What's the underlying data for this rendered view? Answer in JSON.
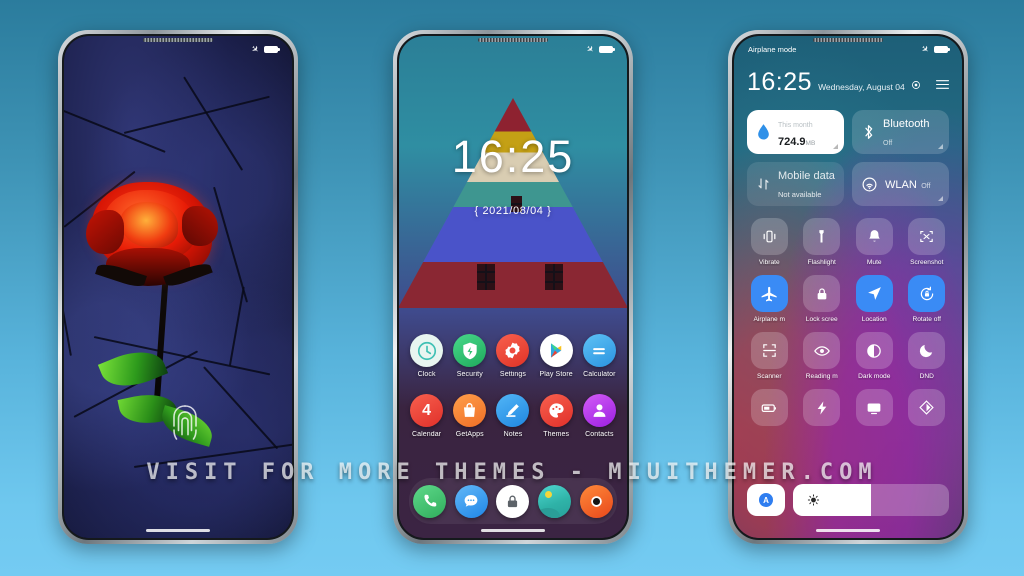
{
  "watermark": "VISIT FOR MORE THEMES - MIUITHEMER.COM",
  "background": {
    "top_color": "#2b7c9d",
    "bottom_color": "#74cbf2"
  },
  "phone1": {
    "name": "lockscreen-rose",
    "statusbar": {
      "plane_icon": "airplane-icon",
      "battery_icon": "battery-icon"
    },
    "wallpaper": "red-rose-on-cracked-blue-stone",
    "fingerprint_icon": "fingerprint-icon"
  },
  "phone2": {
    "name": "homescreen",
    "statusbar": {
      "plane_icon": "airplane-icon",
      "battery_icon": "battery-icon"
    },
    "clock": {
      "time": "16:25",
      "date": "{ 2021/08/04 }"
    },
    "app_rows": [
      [
        {
          "label": "Clock",
          "icon": "clock-icon",
          "bg": "#e8f5f0",
          "fg": "#3fc0b4"
        },
        {
          "label": "Security",
          "icon": "shield-bolt-icon",
          "bg": "#2fc16f",
          "fg": "#ffffff"
        },
        {
          "label": "Settings",
          "icon": "gear-icon",
          "bg": "#ef4a3d",
          "fg": "#ffffff"
        },
        {
          "label": "Play Store",
          "icon": "play-triangle-icon",
          "bg": "#ffffff",
          "fg": "#2fa8e0"
        },
        {
          "label": "Calculator",
          "icon": "equals-icon",
          "bg": "#3aa9e8",
          "fg": "#ffffff"
        }
      ],
      [
        {
          "label": "Calendar",
          "icon": "calendar-4-icon",
          "bg": "#ef4434",
          "fg": "#ffffff"
        },
        {
          "label": "GetApps",
          "icon": "shopping-bag-icon",
          "bg": "#f58134",
          "fg": "#ffffff"
        },
        {
          "label": "Notes",
          "icon": "pencil-icon",
          "bg": "#2e9ef0",
          "fg": "#ffffff"
        },
        {
          "label": "Themes",
          "icon": "palette-icon",
          "bg": "#ef4a3d",
          "fg": "#ffffff"
        },
        {
          "label": "Contacts",
          "icon": "person-icon",
          "bg": "#b93af0",
          "fg": "#ffffff"
        }
      ]
    ],
    "dock": [
      {
        "label": "Phone",
        "icon": "phone-handset-icon",
        "bg": "#45c173",
        "fg": "#ffffff"
      },
      {
        "label": "Messages",
        "icon": "chat-bubble-icon",
        "bg": "#3aa0f0",
        "fg": "#ffffff"
      },
      {
        "label": "Security",
        "icon": "lock-icon",
        "bg": "#ffffff",
        "fg": "#5c6268"
      },
      {
        "label": "Gallery",
        "icon": "photo-sun-icon",
        "bg": "#3fc0b4",
        "fg": "#f5d63a"
      },
      {
        "label": "Browser",
        "icon": "browser-circle-icon",
        "bg": "#f06326",
        "fg": "#111111"
      }
    ]
  },
  "phone3": {
    "name": "control-center",
    "statusbar": {
      "label": "Airplane mode",
      "plane_icon": "airplane-icon",
      "battery_icon": "battery-icon"
    },
    "header": {
      "time": "16:25",
      "date": "Wednesday, August 04",
      "gear_icon": "gear-icon",
      "menu_icon": "hamburger-menu-icon"
    },
    "big_tiles": [
      {
        "icon": "data-drop-icon",
        "line1": "This month",
        "line2": "724.9",
        "unit": "MB",
        "state": "on",
        "name": "data-usage-tile"
      },
      {
        "icon": "bluetooth-icon",
        "line1": "",
        "line2": "Bluetooth",
        "sub": "Off",
        "state": "off",
        "name": "bluetooth-tile"
      },
      {
        "icon": "mobile-data-icon",
        "line1": "",
        "line2": "Mobile data",
        "sub": "Not available",
        "state": "dim",
        "name": "mobile-data-tile"
      },
      {
        "icon": "wlan-icon",
        "line1": "",
        "line2": "WLAN",
        "sub": "Off",
        "state": "off",
        "name": "wlan-tile"
      }
    ],
    "toggle_rows": [
      [
        {
          "label": "Vibrate",
          "icon": "vibrate-icon",
          "active": false
        },
        {
          "label": "Flashlight",
          "icon": "flashlight-icon",
          "active": false
        },
        {
          "label": "Mute",
          "icon": "bell-icon",
          "active": false
        },
        {
          "label": "Screenshot",
          "icon": "screenshot-icon",
          "active": false
        }
      ],
      [
        {
          "label": "Airplane m",
          "icon": "airplane-icon",
          "active": true
        },
        {
          "label": "Lock scree",
          "icon": "lock-icon",
          "active": false
        },
        {
          "label": "Location",
          "icon": "location-arrow-icon",
          "active": true
        },
        {
          "label": "Rotate off",
          "icon": "rotate-lock-icon",
          "active": true
        }
      ],
      [
        {
          "label": "Scanner",
          "icon": "scan-frame-icon",
          "active": false
        },
        {
          "label": "Reading m",
          "icon": "eye-icon",
          "active": false
        },
        {
          "label": "Dark mode",
          "icon": "contrast-icon",
          "active": false
        },
        {
          "label": "DND",
          "icon": "moon-icon",
          "active": false
        }
      ],
      [
        {
          "label": "",
          "icon": "battery-saver-icon",
          "active": false
        },
        {
          "label": "",
          "icon": "lightning-icon",
          "active": false
        },
        {
          "label": "",
          "icon": "cast-screen-icon",
          "active": false
        },
        {
          "label": "",
          "icon": "sync-color-icon",
          "active": false
        }
      ]
    ],
    "brightness": {
      "auto_label": "A",
      "auto_icon": "auto-brightness-icon",
      "slider_icon": "sun-icon",
      "level_percent": 50
    }
  }
}
